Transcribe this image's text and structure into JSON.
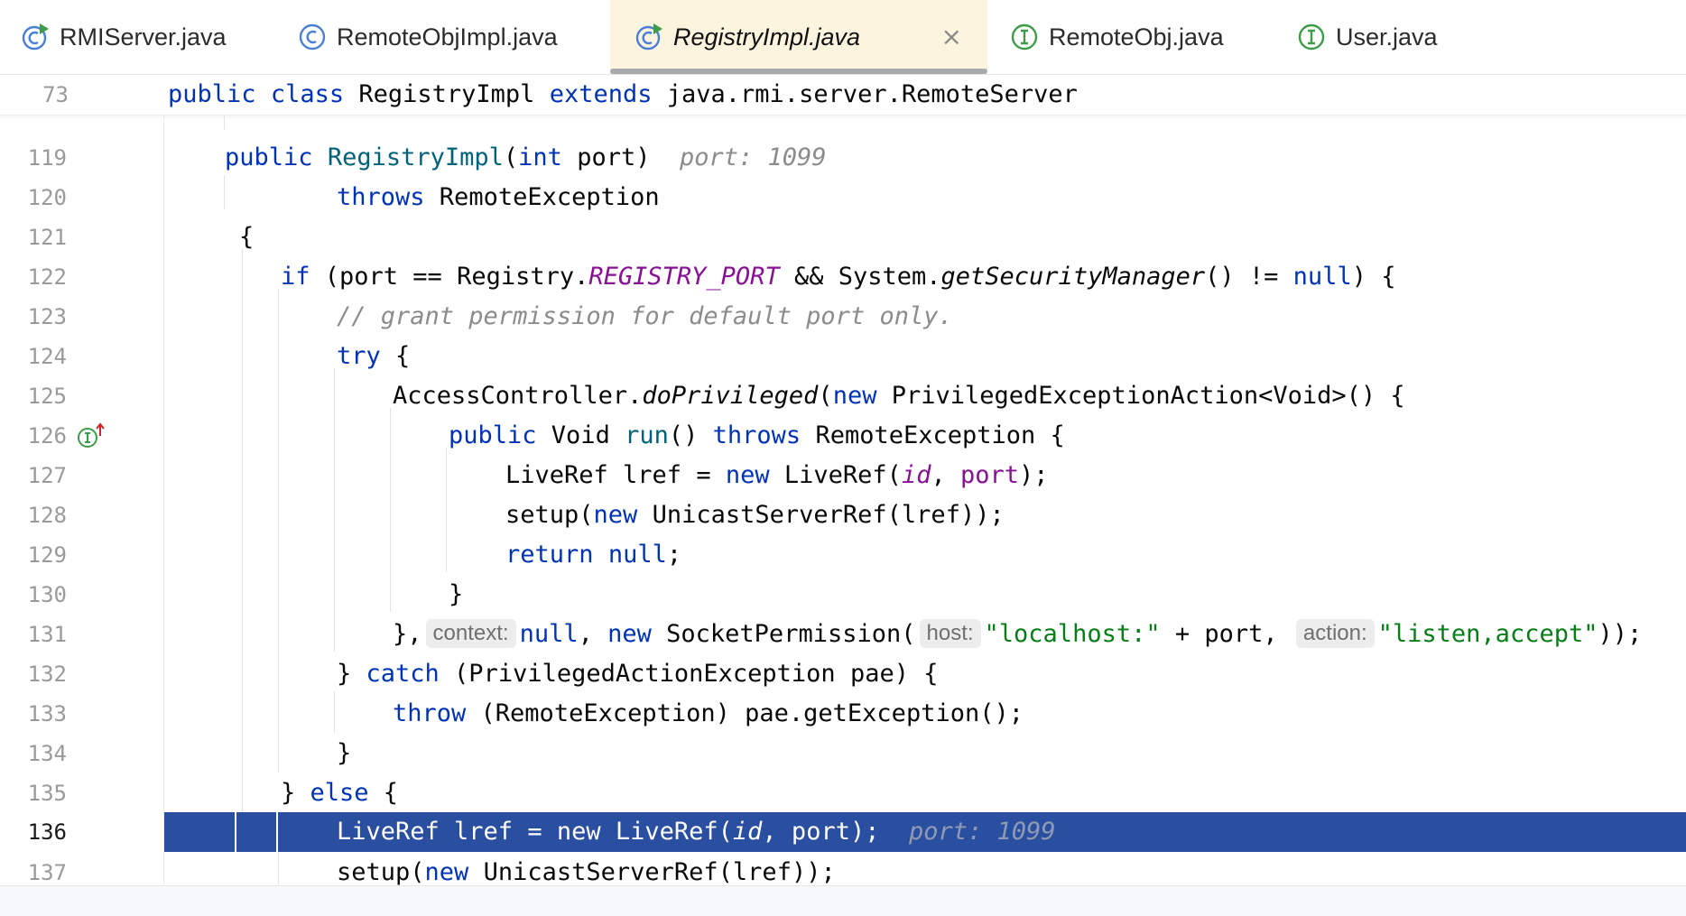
{
  "tabs": [
    {
      "label": "RMIServer.java",
      "icon": "class-run-icon"
    },
    {
      "label": "RemoteObjImpl.java",
      "icon": "class-icon"
    },
    {
      "label": "RegistryImpl.java",
      "icon": "class-run-icon",
      "active": true,
      "close": "×"
    },
    {
      "label": "RemoteObj.java",
      "icon": "interface-icon"
    },
    {
      "label": "User.java",
      "icon": "interface-icon"
    }
  ],
  "sticky": {
    "line_number": "73",
    "kw1": "public",
    "kw2": "class",
    "name": "RegistryImpl",
    "kw3": "extends",
    "rest": "java.rmi.server.RemoteServer"
  },
  "lines": [
    {
      "n": "119"
    },
    {
      "n": "120"
    },
    {
      "n": "121"
    },
    {
      "n": "122"
    },
    {
      "n": "123"
    },
    {
      "n": "124"
    },
    {
      "n": "125"
    },
    {
      "n": "126"
    },
    {
      "n": "127"
    },
    {
      "n": "128"
    },
    {
      "n": "129"
    },
    {
      "n": "130"
    },
    {
      "n": "131"
    },
    {
      "n": "132"
    },
    {
      "n": "133"
    },
    {
      "n": "134"
    },
    {
      "n": "135"
    },
    {
      "n": "136"
    },
    {
      "n": "137"
    }
  ],
  "code": {
    "l119": {
      "kw": "public",
      "fn": "RegistryImpl",
      "p1": "(",
      "kw2": "int",
      "p2": " port)",
      "hint": "port: 1099"
    },
    "l120": {
      "kw": "throws",
      "rest": " RemoteException"
    },
    "l121": {
      "text": "{"
    },
    "l122": {
      "kw": "if",
      "a": " (port == Registry.",
      "st": "REGISTRY_PORT",
      "b": " && System.",
      "it": "getSecurityManager",
      "c": "() != ",
      "kw2": "null",
      "d": ") {"
    },
    "l123": {
      "comment": "// grant permission for default port only."
    },
    "l124": {
      "kw": "try",
      "rest": " {"
    },
    "l125": {
      "a": "AccessController.",
      "it": "doPrivileged",
      "b": "(",
      "kw": "new",
      "c": " PrivilegedExceptionAction<Void>() {"
    },
    "l126": {
      "kw": "public",
      "a": " Void ",
      "fn": "run",
      "b": "() ",
      "kw2": "throws",
      "c": " RemoteException {"
    },
    "l127": {
      "a": "LiveRef lref = ",
      "kw": "new",
      "b": " LiveRef(",
      "pv": "id",
      "c": ", ",
      "pv2": "port",
      "d": ");"
    },
    "l128": {
      "a": "setup(",
      "kw": "new",
      "b": " UnicastServerRef(lref));"
    },
    "l129": {
      "kw": "return",
      "sp": " ",
      "kw2": "null",
      "a": ";"
    },
    "l130": {
      "text": "}"
    },
    "l131": {
      "a": "},",
      "hint1": "context:",
      "kw": "null",
      "b": ", ",
      "kw2": "new",
      "c": " SocketPermission(",
      "hint2": "host:",
      "str1": "\"localhost:\"",
      "d": " + port, ",
      "hint3": "action:",
      "str2": "\"listen,accept\"",
      "e": "));"
    },
    "l132": {
      "a": "} ",
      "kw": "catch",
      "b": " (PrivilegedActionException pae) {"
    },
    "l133": {
      "kw": "throw",
      "a": " (RemoteException) pae.getException();"
    },
    "l134": {
      "text": "}"
    },
    "l135": {
      "a": "} ",
      "kw": "else",
      "b": " {"
    },
    "l136": {
      "a": "LiveRef lref = new LiveRef(",
      "it": "id",
      "b": ", port);",
      "hint": "port: 1099"
    },
    "l137": {
      "a": "setup(",
      "kw": "new",
      "b": " UnicastServerRef(lref));"
    }
  },
  "colors": {
    "keyword": "#0033b3",
    "function": "#00627a",
    "static": "#871094",
    "string": "#067d17",
    "comment": "#8c8c8c",
    "highlight": "#2a4fa0",
    "active_tab": "#fcf4de"
  }
}
